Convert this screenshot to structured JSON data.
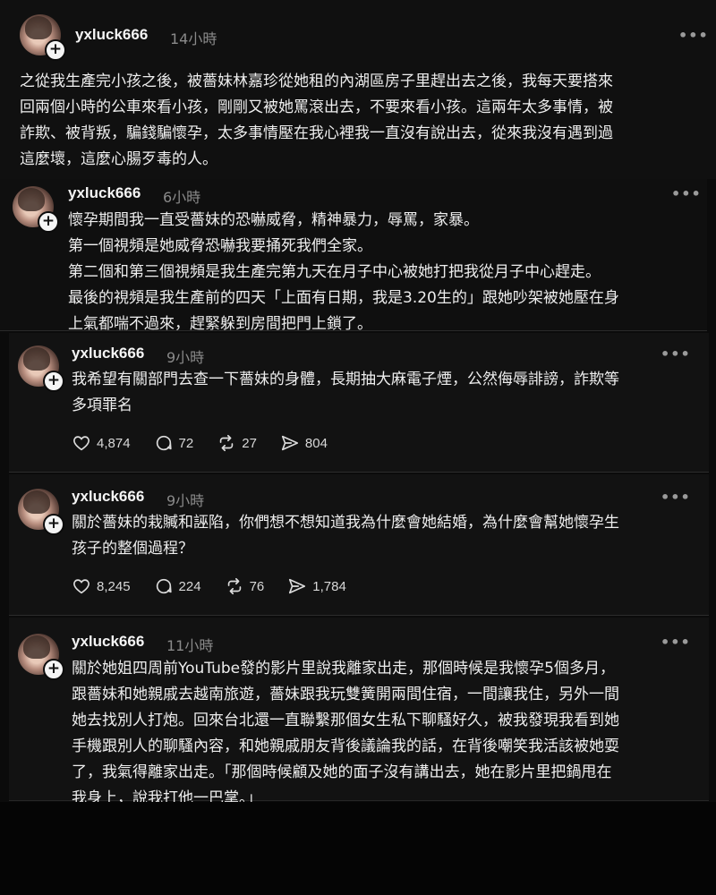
{
  "posts": [
    {
      "username": "yxluck666",
      "time": "14小時",
      "lines": [
        "之從我生產完小孩之後，被薔妹林嘉珍從她租的內湖區房子里趕出去之後，我每天要搭來",
        "回兩個小時的公車來看小孩，剛剛又被她罵滾出去，不要來看小孩。這兩年太多事情，被",
        "詐欺、被背叛，騙錢騙懷孕，太多事情壓在我心裡我一直沒有說出去，從來我沒有遇到過",
        "這麼壞，這麼心腸歹毒的人。"
      ]
    },
    {
      "username": "yxluck666",
      "time": "6小時",
      "lines": [
        "懷孕期間我一直受薔妹的恐嚇威脅，精神暴力，辱罵，家暴。",
        "第一個視頻是她威脅恐嚇我要捅死我們全家。",
        "第二個和第三個視頻是我生產完第九天在月子中心被她打把我從月子中心趕走。",
        "最後的視頻是我生產前的四天「上面有日期，我是3.20生的」跟她吵架被她壓在身",
        "上氣都喘不過來，趕緊躲到房間把門上鎖了。"
      ]
    },
    {
      "username": "yxluck666",
      "time": "9小時",
      "lines": [
        "我希望有關部門去查一下薔妹的身體，長期抽大麻電子煙，公然侮辱誹謗，詐欺等",
        "多項罪名"
      ],
      "likes": "4,874",
      "replies": "72",
      "reposts": "27",
      "shares": "804"
    },
    {
      "username": "yxluck666",
      "time": "9小時",
      "lines": [
        "關於薔妹的栽贓和誣陷，你們想不想知道我為什麼會她結婚，為什麼會幫她懷孕生",
        "孩子的整個過程？"
      ],
      "likes": "8,245",
      "replies": "224",
      "reposts": "76",
      "shares": "1,784"
    },
    {
      "username": "yxluck666",
      "time": "11小時",
      "lines": [
        "關於她姐四周前YouTube發的影片里說我離家出走，那個時候是我懷孕5個多月，",
        "跟薔妹和她親戚去越南旅遊，薔妹跟我玩雙簧開兩間住宿，一間讓我住，另外一間",
        "她去找別人打炮。回來台北還一直聯繫那個女生私下聊騷好久，被我發現我看到她",
        "手機跟別人的聊騷內容，和她親戚朋友背後議論我的話，在背後嘲笑我活該被她耍",
        "了，我氣得離家出走。「那個時候顧及她的面子沒有講出去，她在影片里把鍋甩在",
        "我身上，說我打他一巴掌。」"
      ]
    }
  ],
  "more_glyph": "•••",
  "plus_glyph": "+"
}
